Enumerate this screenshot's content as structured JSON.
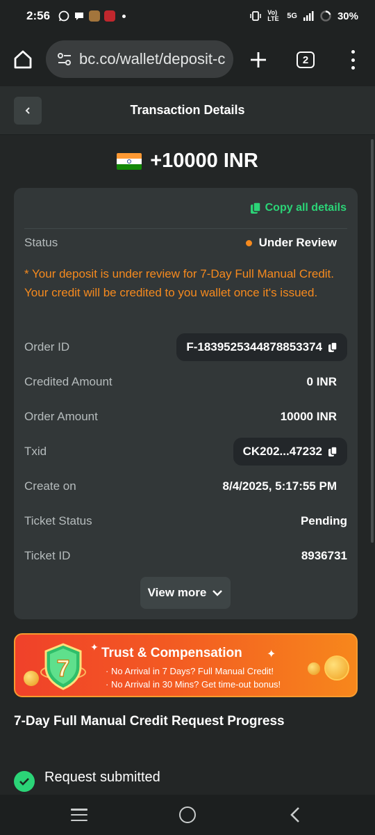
{
  "status_bar": {
    "time": "2:56",
    "network": "5G",
    "battery": "30%",
    "volte": "Vo) LTE"
  },
  "browser": {
    "url": "bc.co/wallet/deposit-c",
    "tab_count": "2"
  },
  "header": {
    "title": "Transaction Details"
  },
  "amount": {
    "text": "+10000 INR",
    "flag": "india-flag"
  },
  "details": {
    "copy_all": "Copy all details",
    "status_label": "Status",
    "status_value": "Under Review",
    "note": "* Your deposit is under review for 7-Day Full Manual Credit. Your credit will be credited to you wallet once it's issued.",
    "rows": [
      {
        "label": "Order ID",
        "value": "F-1839525344878853374"
      },
      {
        "label": "Credited Amount",
        "value": "0 INR"
      },
      {
        "label": "Order Amount",
        "value": "10000 INR"
      },
      {
        "label": "Txid",
        "value": "CK202...47232"
      },
      {
        "label": "Create on",
        "value": "8/4/2025, 5:17:55 PM"
      },
      {
        "label": "Ticket Status",
        "value": "Pending"
      },
      {
        "label": "Ticket ID",
        "value": "8936731"
      }
    ],
    "view_more": "View more"
  },
  "banner": {
    "title": "Trust & Compensation",
    "line1": "· No Arrival in 7 Days? Full Manual Credit!",
    "line2": "· No Arrival in 30 Mins? Get time-out bonus!",
    "badge_number": "7"
  },
  "progress": {
    "title": "7-Day Full Manual Credit Request Progress",
    "steps": [
      {
        "label": "Request submitted"
      }
    ]
  },
  "colors": {
    "accent_green": "#2bd477",
    "status_orange": "#f68a1e",
    "background": "#232626",
    "card": "#323738"
  }
}
